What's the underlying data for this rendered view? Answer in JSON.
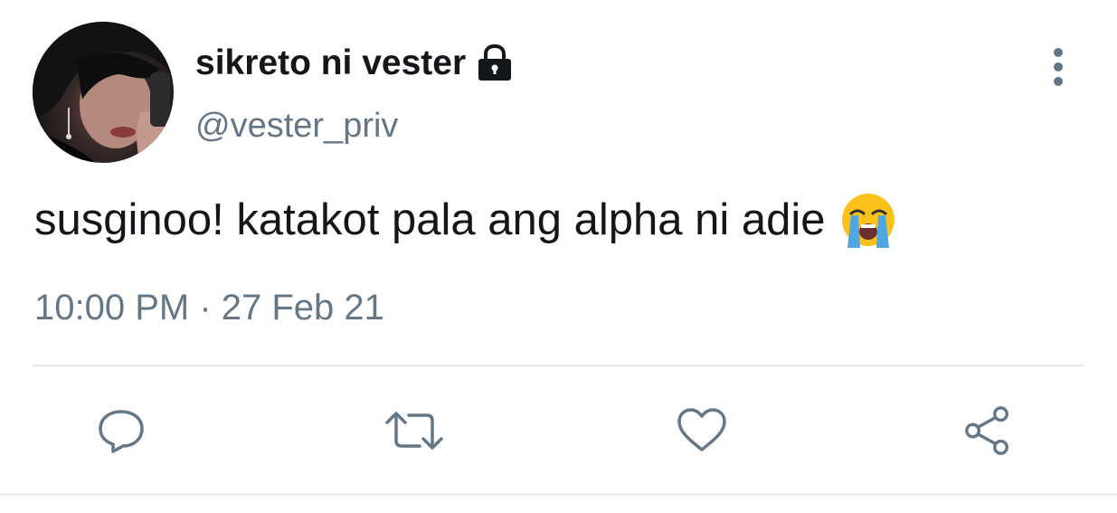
{
  "tweet": {
    "display_name": "sikreto ni vester",
    "handle": "@vester_priv",
    "text": "susginoo! katakot pala ang alpha ni adie",
    "emoji": "loudly-crying-face-icon",
    "timestamp": "10:00 PM · 27 Feb 21",
    "protected_icon": "lock-icon",
    "menu_icon": "more-vertical-icon"
  },
  "actions": [
    {
      "name": "reply",
      "icon": "reply-icon"
    },
    {
      "name": "retweet",
      "icon": "retweet-icon"
    },
    {
      "name": "like",
      "icon": "heart-icon"
    },
    {
      "name": "share",
      "icon": "share-icon"
    }
  ],
  "colors": {
    "text_primary": "#14171a",
    "text_secondary": "#657786",
    "divider": "#e1e8ed"
  }
}
